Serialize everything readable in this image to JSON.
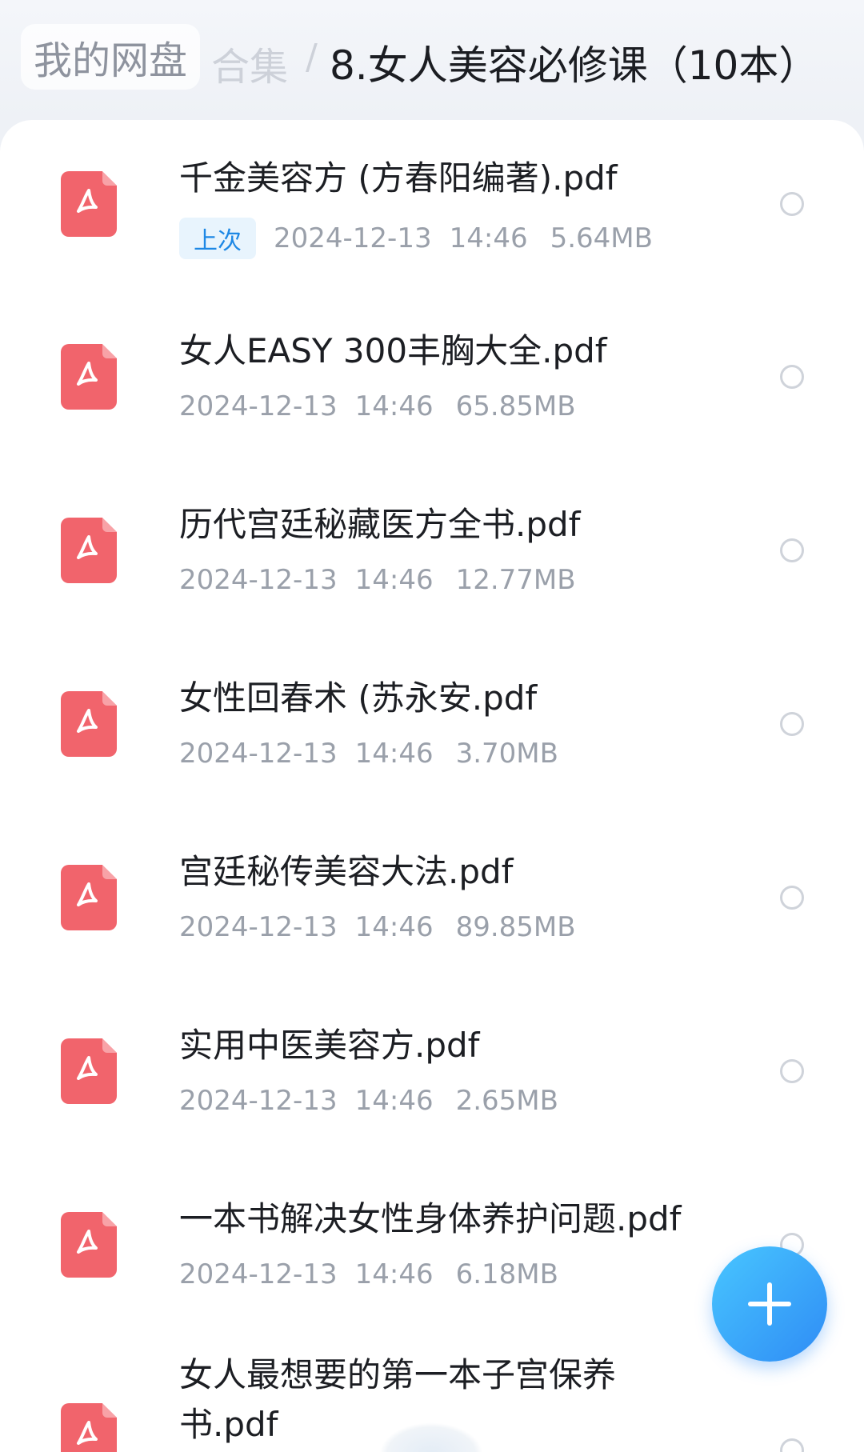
{
  "breadcrumb": {
    "root": "我的网盘",
    "parent": "合集",
    "separator": "/",
    "current": "8.女人美容必修课（10本）"
  },
  "files": [
    {
      "name": "千金美容方 (方春阳编著).pdf",
      "badge": "上次",
      "date": "2024-12-13",
      "time": "14:46",
      "size": "5.64MB",
      "icon": "pdf-icon"
    },
    {
      "name": "女人EASY 300丰胸大全.pdf",
      "date": "2024-12-13",
      "time": "14:46",
      "size": "65.85MB",
      "icon": "pdf-icon"
    },
    {
      "name": "历代宫廷秘藏医方全书.pdf",
      "date": "2024-12-13",
      "time": "14:46",
      "size": "12.77MB",
      "icon": "pdf-icon"
    },
    {
      "name": "女性回春术 (苏永安.pdf",
      "date": "2024-12-13",
      "time": "14:46",
      "size": "3.70MB",
      "icon": "pdf-icon"
    },
    {
      "name": "宫廷秘传美容大法.pdf",
      "date": "2024-12-13",
      "time": "14:46",
      "size": "89.85MB",
      "icon": "pdf-icon"
    },
    {
      "name": "实用中医美容方.pdf",
      "date": "2024-12-13",
      "time": "14:46",
      "size": "2.65MB",
      "icon": "pdf-icon"
    },
    {
      "name": "一本书解决女性身体养护问题.pdf",
      "date": "2024-12-13",
      "time": "14:46",
      "size": "6.18MB",
      "icon": "pdf-icon"
    },
    {
      "name": "女人最想要的第一本子宫保养书.pdf",
      "icon": "pdf-icon"
    }
  ],
  "fab": {
    "icon": "plus-icon"
  },
  "colors": {
    "accent": "#2f8cf5",
    "pdf": "#f1646c",
    "badge_text": "#1e88e5"
  }
}
